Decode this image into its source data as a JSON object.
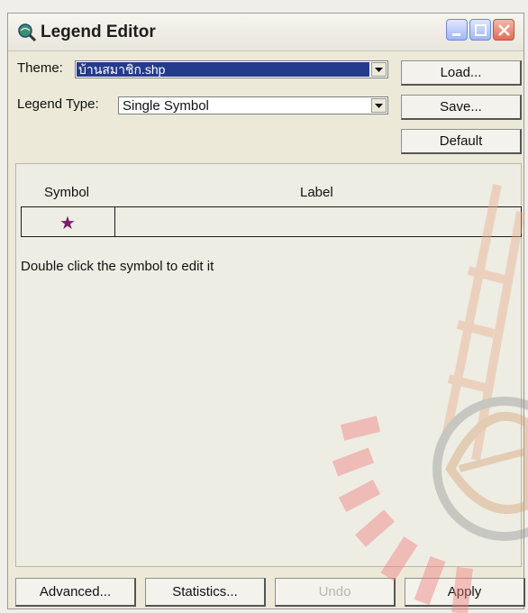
{
  "window": {
    "title": "Legend Editor"
  },
  "theme": {
    "label": "Theme:",
    "value": "บ้านสมาชิก.shp"
  },
  "legend_type": {
    "label": "Legend Type:",
    "value": "Single Symbol"
  },
  "buttons": {
    "load": "Load...",
    "save": "Save...",
    "default": "Default",
    "advanced": "Advanced...",
    "statistics": "Statistics...",
    "undo": "Undo",
    "apply": "Apply"
  },
  "table": {
    "symbol_header": "Symbol",
    "label_header": "Label",
    "rows": [
      {
        "symbol": "★",
        "label": ""
      }
    ]
  },
  "hint": "Double click the symbol to edit it",
  "colors": {
    "symbol_star": "#7a1e6a",
    "selection": "#243a8c"
  }
}
